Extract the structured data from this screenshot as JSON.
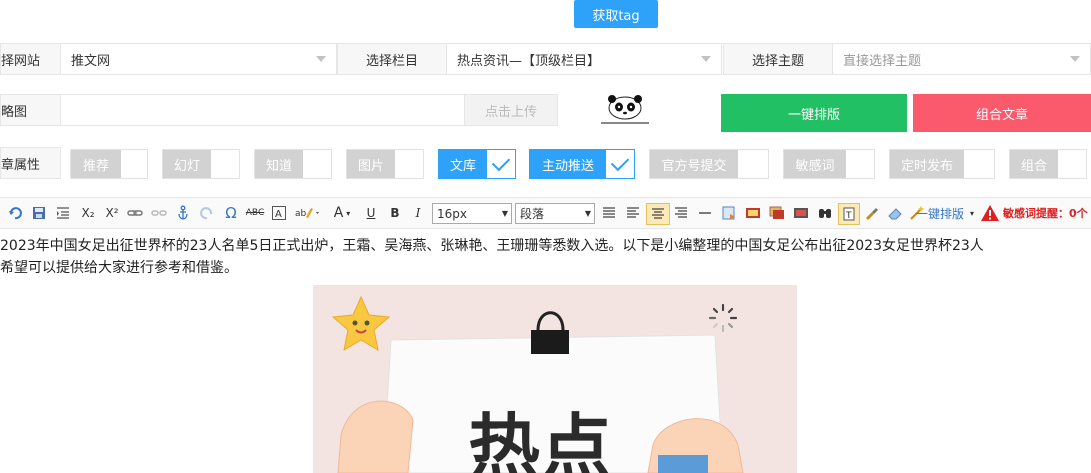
{
  "actions": {
    "get_tag": "获取tag",
    "upload": "点击上传",
    "one_click_layout": "一键排版",
    "combine_article": "组合文章"
  },
  "row1": {
    "site_label": "择网站",
    "site_value": "推文网",
    "column_label": "选择栏目",
    "column_value": "热点资讯—【顶级栏目】",
    "topic_label": "选择主题",
    "topic_placeholder": "直接选择主题"
  },
  "row2": {
    "thumb_label": "略图",
    "logo_text": "熊猫"
  },
  "row3": {
    "attr_label": "章属性",
    "toggles": [
      {
        "label": "推荐",
        "on": false
      },
      {
        "label": "幻灯",
        "on": false
      },
      {
        "label": "知道",
        "on": false
      },
      {
        "label": "图片",
        "on": false
      },
      {
        "label": "文库",
        "on": true
      },
      {
        "label": "主动推送",
        "on": true
      },
      {
        "label": "官方号提交",
        "on": false
      },
      {
        "label": "敏感词",
        "on": false
      },
      {
        "label": "定时发布",
        "on": false
      },
      {
        "label": "组合",
        "on": false
      }
    ]
  },
  "toolbar": {
    "font_size": "16px",
    "paragraph": "段落",
    "one_click_layout": "一键排版",
    "sensitive_hint": "敏感词提醒：0个",
    "text_a_label": "A",
    "text_u_label": "U",
    "text_b_label": "B",
    "text_i_label": "I",
    "abc_label": "ABC",
    "omega_label": "Ω",
    "x_sub_label": "X₂",
    "x_sup_label": "X²"
  },
  "article": {
    "line1": "2023年中国女足出征世界杯的23人名单5日正式出炉，王霜、吴海燕、张琳艳、王珊珊等悉数入选。以下是小编整理的中国女足公布出征2023女足世界杯23人",
    "line2": "希望可以提供给大家进行参考和借鉴。",
    "image_text": "热点"
  },
  "colors": {
    "blue": "#2ea1f8",
    "green": "#21c064",
    "red": "#fb5a6c",
    "gray_toggle": "#d2d2d2"
  }
}
